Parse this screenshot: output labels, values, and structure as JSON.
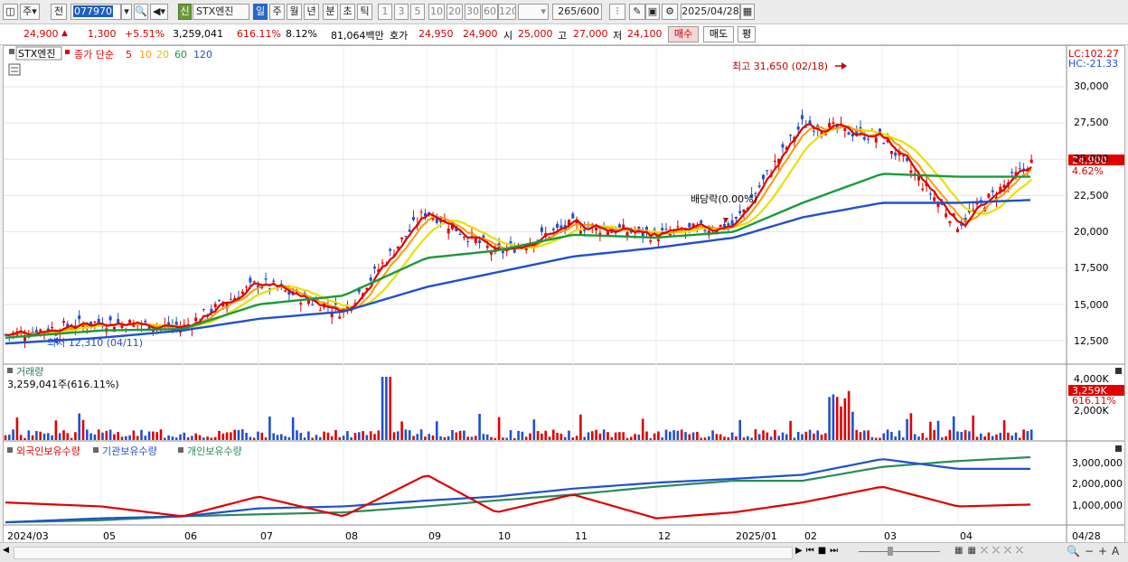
{
  "toolbar": {
    "period": "주",
    "prev": "전",
    "code": "077970",
    "shin": "신",
    "name": "STX엔진",
    "periods": [
      "일",
      "주",
      "월",
      "년",
      "분",
      "초",
      "틱"
    ],
    "active_period": "일",
    "nums": [
      "1",
      "3",
      "5",
      "10",
      "20",
      "30",
      "60",
      "120"
    ],
    "count": "265",
    "count_total": "/600",
    "date": "2025/04/28"
  },
  "quote": {
    "price": "24,900",
    "arrow": "▲",
    "change": "1,300",
    "rate": "+5.51%",
    "volume": "3,259,041",
    "vol_ratio": "616.11%",
    "turnover": "8.12%",
    "amount": "81,064백만",
    "hoga_label": "호가",
    "ask": "24,950",
    "bid": "24,900",
    "open_label": "시",
    "open": "25,000",
    "high_label": "고",
    "high": "27,000",
    "low_label": "저",
    "low": "24,100",
    "buy": "매수",
    "sell": "매도",
    "avg": "평"
  },
  "price_panel": {
    "legend_name": "STX엔진",
    "legend_type": "종가 단순",
    "ma_labels": [
      "5",
      "10",
      "20",
      "60",
      "120"
    ],
    "ma_colors": [
      "#e00000",
      "#ff9900",
      "#e8e000",
      "#1a9a3a",
      "#2050d0"
    ],
    "lc": "LC:102.27",
    "hc": "HC:-21.33",
    "high_note": "최고 31,650 (02/18)",
    "low_note": "최저 12,310 (04/11)",
    "div_note": "배당락(0.00%)",
    "last_price_tag": "24,900",
    "last_pct_tag": "4.62%",
    "y_ticks": [
      "30,000",
      "27,500",
      "25,000",
      "22,500",
      "20,000",
      "17,500",
      "15,000",
      "12,500"
    ]
  },
  "volume_panel": {
    "title": "거래량",
    "info": "3,259,041주(616.11%)",
    "y_ticks": [
      "4,000K",
      "2,000K"
    ],
    "tag": "3,259K",
    "tag_pct": "616.11%"
  },
  "holding_panel": {
    "series": [
      "외국인보유수량",
      "기관보유수량",
      "개인보유수량"
    ],
    "colors": [
      "#e00000",
      "#2050d0",
      "#2a8a5a"
    ],
    "y_ticks": [
      "3,000,000",
      "2,000,000",
      "1,000,000"
    ]
  },
  "x_axis": [
    "2024/03",
    "05",
    "06",
    "07",
    "08",
    "09",
    "10",
    "11",
    "12",
    "2025/01",
    "02",
    "03",
    "04",
    "04/28"
  ],
  "chart_data": {
    "type": "line",
    "title": "STX엔진",
    "x": [
      "2024/03",
      "05",
      "06",
      "07",
      "08",
      "09",
      "10",
      "11",
      "12",
      "2025/01",
      "02",
      "03",
      "04",
      "04/28"
    ],
    "ylim": [
      12500,
      30000
    ],
    "series": [
      {
        "name": "종가",
        "values": [
          12900,
          13800,
          13400,
          16500,
          14500,
          21500,
          18500,
          20500,
          19800,
          20500,
          27500,
          26500,
          20500,
          24900
        ]
      },
      {
        "name": "60",
        "values": [
          12700,
          13200,
          13300,
          15000,
          15600,
          18200,
          18700,
          19800,
          19600,
          20000,
          22000,
          24000,
          23800,
          23800
        ]
      },
      {
        "name": "120",
        "values": [
          12300,
          12700,
          13200,
          14000,
          14500,
          16200,
          17200,
          18300,
          18900,
          19600,
          21000,
          22000,
          22000,
          22200
        ]
      }
    ],
    "extremes": {
      "high": 31650,
      "high_date": "02/18",
      "low": 12310,
      "low_date": "04/11"
    }
  }
}
